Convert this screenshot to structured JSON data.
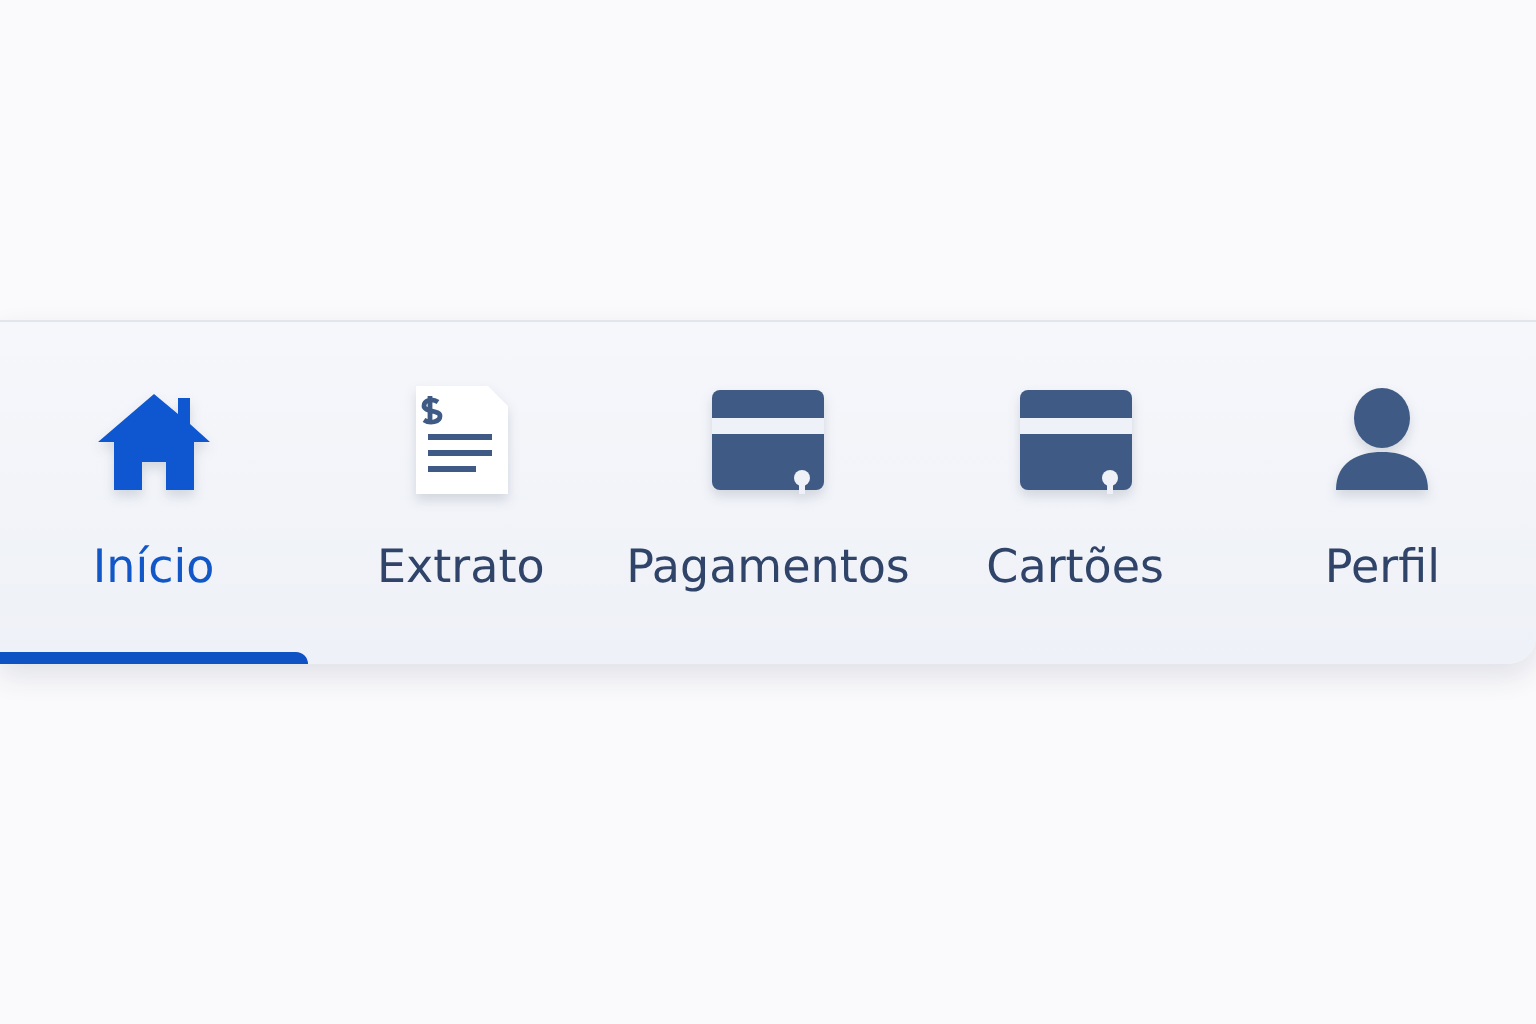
{
  "nav_bar": {
    "tabs": [
      {
        "label": "Início",
        "kind": "home",
        "selected": true
      },
      {
        "label": "Extrato",
        "kind": "statement",
        "selected": false
      },
      {
        "label": "Pagamentos",
        "kind": "card",
        "selected": false
      },
      {
        "label": "Cartões",
        "kind": "card",
        "selected": false
      },
      {
        "label": "Perfil",
        "kind": "profile",
        "selected": false
      }
    ]
  }
}
